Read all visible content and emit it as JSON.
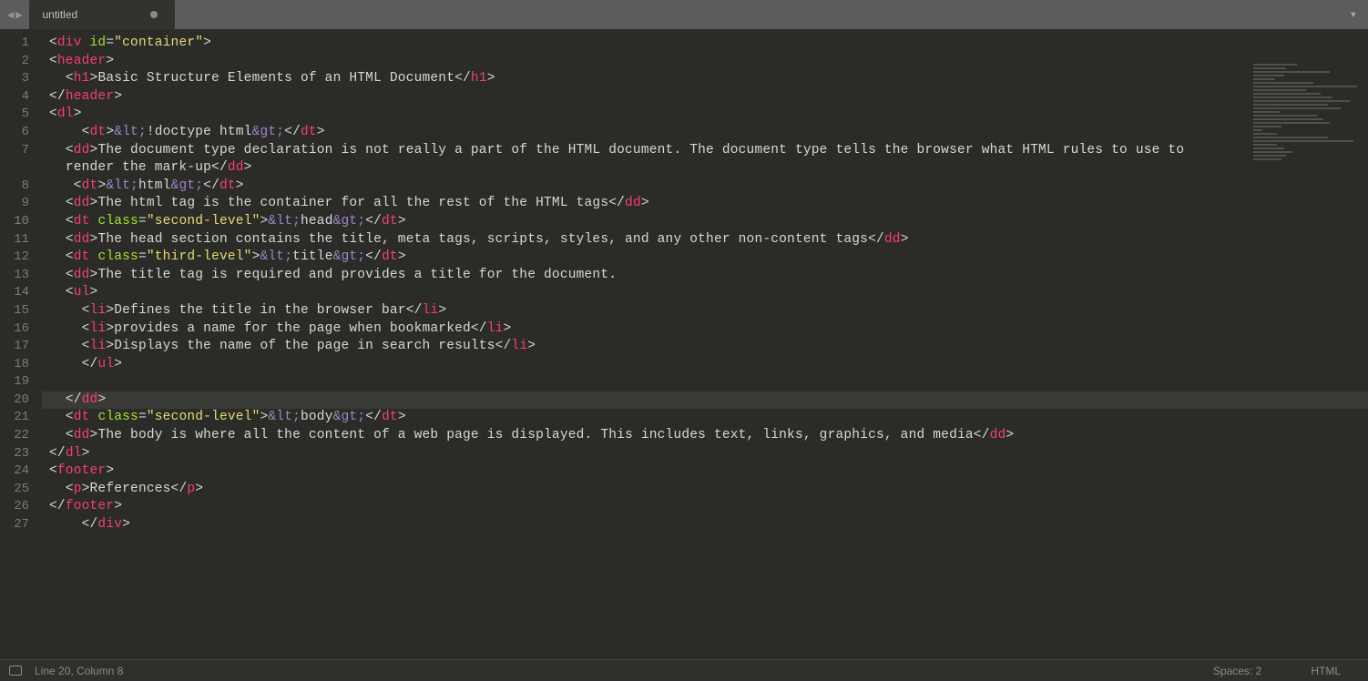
{
  "tab": {
    "title": "untitled",
    "dirty": true
  },
  "status": {
    "position": "Line 20, Column 8",
    "indent": "Spaces: 2",
    "syntax": "HTML"
  },
  "highlight_line": 20,
  "code": [
    {
      "n": 1,
      "indent": 0,
      "tokens": [
        [
          "p",
          "<"
        ],
        [
          "tag",
          "div"
        ],
        [
          "p",
          " "
        ],
        [
          "attr",
          "id"
        ],
        [
          "p",
          "="
        ],
        [
          "str",
          "\"container\""
        ],
        [
          "p",
          ">"
        ]
      ]
    },
    {
      "n": 2,
      "indent": 0,
      "tokens": [
        [
          "p",
          "<"
        ],
        [
          "tag",
          "header"
        ],
        [
          "p",
          ">"
        ]
      ]
    },
    {
      "n": 3,
      "indent": 1,
      "tokens": [
        [
          "p",
          "<"
        ],
        [
          "tag",
          "h1"
        ],
        [
          "p",
          ">"
        ],
        [
          "txt",
          "Basic Structure Elements of an HTML Document"
        ],
        [
          "p",
          "</"
        ],
        [
          "tag",
          "h1"
        ],
        [
          "p",
          ">"
        ]
      ]
    },
    {
      "n": 4,
      "indent": 0,
      "tokens": [
        [
          "p",
          "</"
        ],
        [
          "tag",
          "header"
        ],
        [
          "p",
          ">"
        ]
      ]
    },
    {
      "n": 5,
      "indent": 0,
      "tokens": [
        [
          "p",
          "<"
        ],
        [
          "tag",
          "dl"
        ],
        [
          "p",
          ">"
        ]
      ]
    },
    {
      "n": 6,
      "indent": 2,
      "tokens": [
        [
          "p",
          "<"
        ],
        [
          "tag",
          "dt"
        ],
        [
          "p",
          ">"
        ],
        [
          "ent",
          "&lt;"
        ],
        [
          "txt",
          "!doctype html"
        ],
        [
          "ent",
          "&gt;"
        ],
        [
          "p",
          "</"
        ],
        [
          "tag",
          "dt"
        ],
        [
          "p",
          ">"
        ]
      ]
    },
    {
      "n": 7,
      "indent": 1,
      "tokens": [
        [
          "p",
          "<"
        ],
        [
          "tag",
          "dd"
        ],
        [
          "p",
          ">"
        ],
        [
          "txt",
          "The document type declaration is not really a part of the HTML document. The document type tells the browser what HTML rules to use to render the mark-up"
        ],
        [
          "p",
          "</"
        ],
        [
          "tag",
          "dd"
        ],
        [
          "p",
          ">"
        ]
      ],
      "wrap": true
    },
    {
      "n": 8,
      "indent": 1,
      "tokens": [
        [
          "p",
          " <"
        ],
        [
          "tag",
          "dt"
        ],
        [
          "p",
          ">"
        ],
        [
          "ent",
          "&lt;"
        ],
        [
          "txt",
          "html"
        ],
        [
          "ent",
          "&gt;"
        ],
        [
          "p",
          "</"
        ],
        [
          "tag",
          "dt"
        ],
        [
          "p",
          ">"
        ]
      ]
    },
    {
      "n": 9,
      "indent": 1,
      "tokens": [
        [
          "p",
          "<"
        ],
        [
          "tag",
          "dd"
        ],
        [
          "p",
          ">"
        ],
        [
          "txt",
          "The html tag is the container for all the rest of the HTML tags"
        ],
        [
          "p",
          "</"
        ],
        [
          "tag",
          "dd"
        ],
        [
          "p",
          ">"
        ]
      ]
    },
    {
      "n": 10,
      "indent": 1,
      "tokens": [
        [
          "p",
          "<"
        ],
        [
          "tag",
          "dt"
        ],
        [
          "p",
          " "
        ],
        [
          "attr",
          "class"
        ],
        [
          "p",
          "="
        ],
        [
          "str",
          "\"second-level\""
        ],
        [
          "p",
          ">"
        ],
        [
          "ent",
          "&lt;"
        ],
        [
          "txt",
          "head"
        ],
        [
          "ent",
          "&gt;"
        ],
        [
          "p",
          "</"
        ],
        [
          "tag",
          "dt"
        ],
        [
          "p",
          ">"
        ]
      ]
    },
    {
      "n": 11,
      "indent": 1,
      "tokens": [
        [
          "p",
          "<"
        ],
        [
          "tag",
          "dd"
        ],
        [
          "p",
          ">"
        ],
        [
          "txt",
          "The head section contains the title, meta tags, scripts, styles, and any other non-content tags"
        ],
        [
          "p",
          "</"
        ],
        [
          "tag",
          "dd"
        ],
        [
          "p",
          ">"
        ]
      ]
    },
    {
      "n": 12,
      "indent": 1,
      "tokens": [
        [
          "p",
          "<"
        ],
        [
          "tag",
          "dt"
        ],
        [
          "p",
          " "
        ],
        [
          "attr",
          "class"
        ],
        [
          "p",
          "="
        ],
        [
          "str",
          "\"third-level\""
        ],
        [
          "p",
          ">"
        ],
        [
          "ent",
          "&lt;"
        ],
        [
          "txt",
          "title"
        ],
        [
          "ent",
          "&gt;"
        ],
        [
          "p",
          "</"
        ],
        [
          "tag",
          "dt"
        ],
        [
          "p",
          ">"
        ]
      ]
    },
    {
      "n": 13,
      "indent": 1,
      "tokens": [
        [
          "p",
          "<"
        ],
        [
          "tag",
          "dd"
        ],
        [
          "p",
          ">"
        ],
        [
          "txt",
          "The title tag is required and provides a title for the document."
        ]
      ]
    },
    {
      "n": 14,
      "indent": 1,
      "tokens": [
        [
          "p",
          "<"
        ],
        [
          "tag",
          "ul"
        ],
        [
          "p",
          ">"
        ]
      ]
    },
    {
      "n": 15,
      "indent": 2,
      "tokens": [
        [
          "p",
          "<"
        ],
        [
          "tag",
          "li"
        ],
        [
          "p",
          ">"
        ],
        [
          "txt",
          "Defines the title in the browser bar"
        ],
        [
          "p",
          "</"
        ],
        [
          "tag",
          "li"
        ],
        [
          "p",
          ">"
        ]
      ]
    },
    {
      "n": 16,
      "indent": 2,
      "tokens": [
        [
          "p",
          "<"
        ],
        [
          "tag",
          "li"
        ],
        [
          "p",
          ">"
        ],
        [
          "txt",
          "provides a name for the page when bookmarked"
        ],
        [
          "p",
          "</"
        ],
        [
          "tag",
          "li"
        ],
        [
          "p",
          ">"
        ]
      ]
    },
    {
      "n": 17,
      "indent": 2,
      "tokens": [
        [
          "p",
          "<"
        ],
        [
          "tag",
          "li"
        ],
        [
          "p",
          ">"
        ],
        [
          "txt",
          "Displays the name of the page in search results"
        ],
        [
          "p",
          "</"
        ],
        [
          "tag",
          "li"
        ],
        [
          "p",
          ">"
        ]
      ]
    },
    {
      "n": 18,
      "indent": 2,
      "tokens": [
        [
          "p",
          "</"
        ],
        [
          "tag",
          "ul"
        ],
        [
          "p",
          ">"
        ]
      ]
    },
    {
      "n": 19,
      "indent": 0,
      "tokens": []
    },
    {
      "n": 20,
      "indent": 1,
      "tokens": [
        [
          "p",
          "</"
        ],
        [
          "tag",
          "dd"
        ],
        [
          "p",
          ">"
        ]
      ]
    },
    {
      "n": 21,
      "indent": 1,
      "tokens": [
        [
          "p",
          "<"
        ],
        [
          "tag",
          "dt"
        ],
        [
          "p",
          " "
        ],
        [
          "attr",
          "class"
        ],
        [
          "p",
          "="
        ],
        [
          "str",
          "\"second-level\""
        ],
        [
          "p",
          ">"
        ],
        [
          "ent",
          "&lt;"
        ],
        [
          "txt",
          "body"
        ],
        [
          "ent",
          "&gt;"
        ],
        [
          "p",
          "</"
        ],
        [
          "tag",
          "dt"
        ],
        [
          "p",
          ">"
        ]
      ]
    },
    {
      "n": 22,
      "indent": 1,
      "tokens": [
        [
          "p",
          "<"
        ],
        [
          "tag",
          "dd"
        ],
        [
          "p",
          ">"
        ],
        [
          "txt",
          "The body is where all the content of a web page is displayed. This includes text, links, graphics, and media"
        ],
        [
          "p",
          "</"
        ],
        [
          "tag",
          "dd"
        ],
        [
          "p",
          ">"
        ]
      ]
    },
    {
      "n": 23,
      "indent": 0,
      "tokens": [
        [
          "p",
          "</"
        ],
        [
          "tag",
          "dl"
        ],
        [
          "p",
          ">"
        ]
      ]
    },
    {
      "n": 24,
      "indent": 0,
      "tokens": [
        [
          "p",
          "<"
        ],
        [
          "tag",
          "footer"
        ],
        [
          "p",
          ">"
        ]
      ]
    },
    {
      "n": 25,
      "indent": 1,
      "tokens": [
        [
          "p",
          "<"
        ],
        [
          "tag",
          "p"
        ],
        [
          "p",
          ">"
        ],
        [
          "txt",
          "References"
        ],
        [
          "p",
          "</"
        ],
        [
          "tag",
          "p"
        ],
        [
          "p",
          ">"
        ]
      ]
    },
    {
      "n": 26,
      "indent": 0,
      "tokens": [
        [
          "p",
          "</"
        ],
        [
          "tag",
          "footer"
        ],
        [
          "p",
          ">"
        ]
      ]
    },
    {
      "n": 27,
      "indent": 2,
      "tokens": [
        [
          "p",
          "</"
        ],
        [
          "tag",
          "div"
        ],
        [
          "p",
          ">"
        ]
      ]
    }
  ]
}
